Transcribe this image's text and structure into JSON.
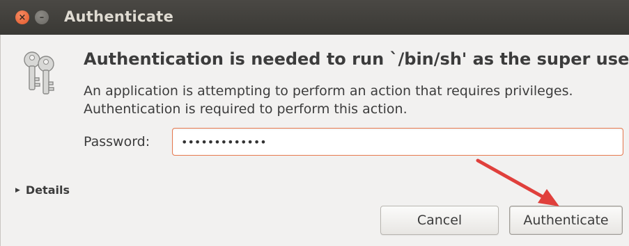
{
  "window": {
    "title": "Authenticate",
    "close_glyph": "×",
    "minimize_glyph": "–"
  },
  "dialog": {
    "heading": "Authentication is needed to run `/bin/sh' as the super user",
    "message": "An application is attempting to perform an action that requires privileges. Authentication is required to perform this action.",
    "password_label": "Password:",
    "password_value": "•••••••••••••",
    "details_label": "Details",
    "cancel_label": "Cancel",
    "authenticate_label": "Authenticate"
  },
  "icons": {
    "dialog_icon": "keys-icon",
    "disclosure": "triangle-right-icon"
  },
  "colors": {
    "titlebar": "#3c3b37",
    "close_button": "#e4582a",
    "input_focus_border": "#e7784e",
    "annotation_arrow": "#e0403c"
  }
}
